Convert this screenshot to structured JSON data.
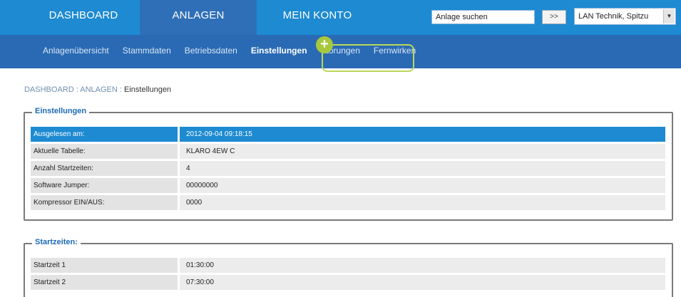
{
  "topnav": {
    "tabs": [
      {
        "label": "DASHBOARD"
      },
      {
        "label": "ANLAGEN"
      },
      {
        "label": "MEIN KONTO"
      }
    ],
    "search": {
      "value": "Anlage suchen",
      "button": ">>"
    },
    "select": {
      "value": "LAN Technik, Spitzu"
    }
  },
  "subnav": {
    "items": [
      {
        "label": "Anlagenübersicht"
      },
      {
        "label": "Stammdaten"
      },
      {
        "label": "Betriebsdaten"
      },
      {
        "label": "Einstellungen"
      },
      {
        "label": "Störungen"
      },
      {
        "label": "Fernwirken"
      }
    ]
  },
  "breadcrumb": {
    "a": "DASHBOARD",
    "sep1": " : ",
    "b": "ANLAGEN",
    "sep2": " : ",
    "current": "Einstellungen"
  },
  "einstellungen": {
    "legend": "Einstellungen",
    "rows": [
      {
        "key": "Ausgelesen am:",
        "value": "2012-09-04 09:18:15"
      },
      {
        "key": "Aktuelle Tabelle:",
        "value": "KLARO 4EW C"
      },
      {
        "key": "Anzahl Startzeiten:",
        "value": "4"
      },
      {
        "key": "Software Jumper:",
        "value": "00000000"
      },
      {
        "key": "Kompressor EIN/AUS:",
        "value": "0000"
      }
    ]
  },
  "startzeiten": {
    "legend": "Startzeiten:",
    "rows": [
      {
        "key": "Startzeit 1",
        "value": "01:30:00"
      },
      {
        "key": "Startzeit 2",
        "value": "07:30:00"
      }
    ]
  },
  "colors": {
    "primary": "#1d8ad2",
    "subnav": "#2a6ab4",
    "active_tab": "#2f6fb7",
    "highlight": "#b9d85a"
  }
}
